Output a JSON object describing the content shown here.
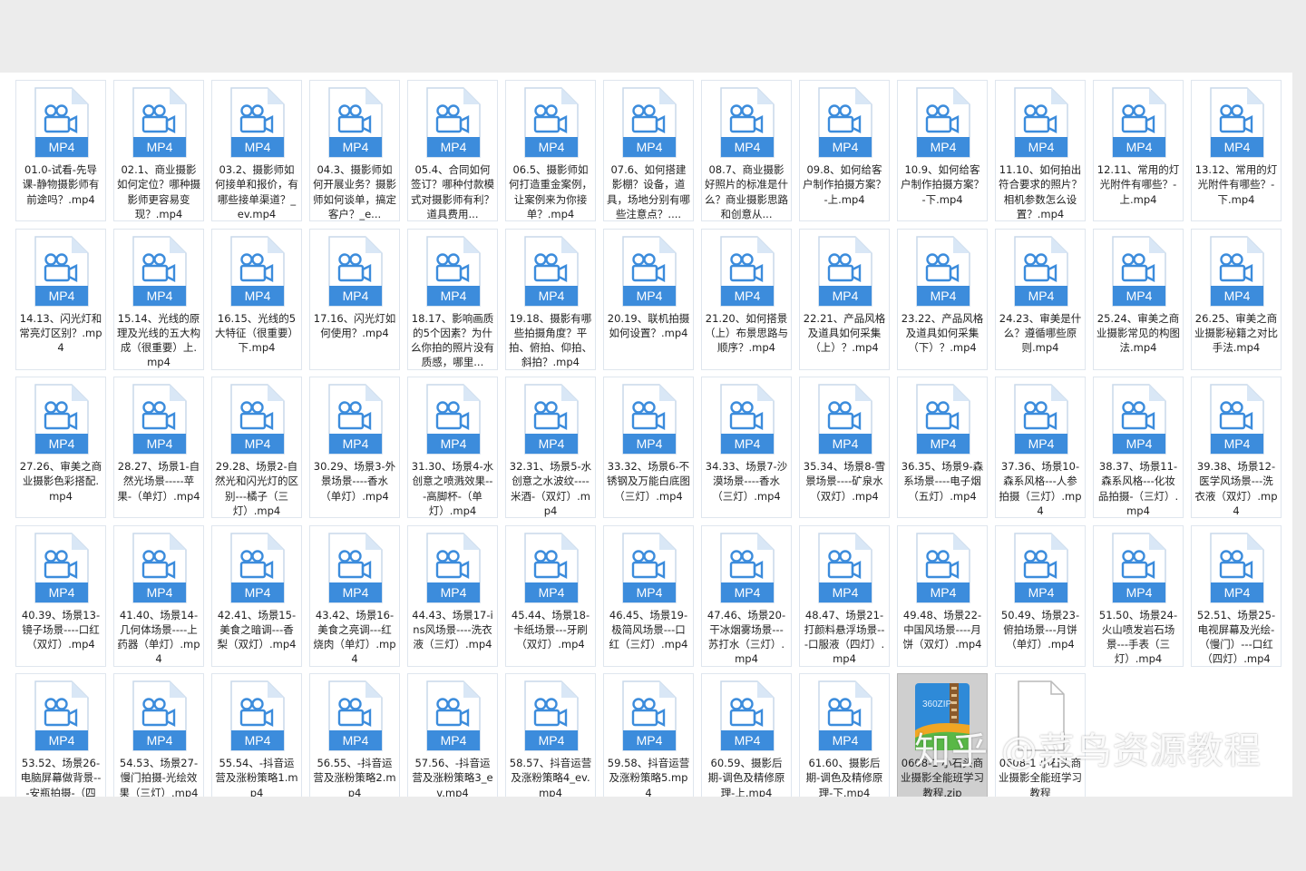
{
  "file_list": {
    "icons": {
      "mp4": "mp4-video-file-icon",
      "zip": "360zip-archive-icon",
      "blank": "blank-document-icon"
    },
    "colors": {
      "mp4_blue": "#3c8cdc",
      "folder_bg": "#ffffff"
    },
    "items": [
      {
        "type": "mp4",
        "badge": "MP4",
        "name": "01.0-试看-先导课-静物摄影师有前途吗？.mp4"
      },
      {
        "type": "mp4",
        "badge": "MP4",
        "name": "02.1、商业摄影如何定位？哪种摄影师更容易变现？.mp4"
      },
      {
        "type": "mp4",
        "badge": "MP4",
        "name": "03.2、摄影师如何接单和报价，有哪些接单渠道？_ev.mp4"
      },
      {
        "type": "mp4",
        "badge": "MP4",
        "name": "04.3、摄影师如何开展业务？摄影师如何谈单，搞定客户？_e..."
      },
      {
        "type": "mp4",
        "badge": "MP4",
        "name": "05.4、合同如何签订？哪种付款模式对摄影师有利？道具费用..."
      },
      {
        "type": "mp4",
        "badge": "MP4",
        "name": "06.5、摄影师如何打造重金案例，让案例来为你接单？.mp4"
      },
      {
        "type": "mp4",
        "badge": "MP4",
        "name": "07.6、如何搭建影棚？设备，道具，场地分别有哪些注意点？...."
      },
      {
        "type": "mp4",
        "badge": "MP4",
        "name": "08.7、商业摄影好照片的标准是什么？商业摄影思路和创意从..."
      },
      {
        "type": "mp4",
        "badge": "MP4",
        "name": "09.8、如何给客户制作拍摄方案？-上.mp4"
      },
      {
        "type": "mp4",
        "badge": "MP4",
        "name": "10.9、如何给客户制作拍摄方案？-下.mp4"
      },
      {
        "type": "mp4",
        "badge": "MP4",
        "name": "11.10、如何拍出符合要求的照片？相机参数怎么设置？.mp4"
      },
      {
        "type": "mp4",
        "badge": "MP4",
        "name": "12.11、常用的灯光附件有哪些？-上.mp4"
      },
      {
        "type": "mp4",
        "badge": "MP4",
        "name": "13.12、常用的灯光附件有哪些？-下.mp4"
      },
      {
        "type": "mp4",
        "badge": "MP4",
        "name": "14.13、闪光灯和常亮灯区别？.mp4"
      },
      {
        "type": "mp4",
        "badge": "MP4",
        "name": "15.14、光线的原理及光线的五大构成（很重要）上.mp4"
      },
      {
        "type": "mp4",
        "badge": "MP4",
        "name": "16.15、光线的5大特征（很重要）下.mp4"
      },
      {
        "type": "mp4",
        "badge": "MP4",
        "name": "17.16、闪光灯如何使用？.mp4"
      },
      {
        "type": "mp4",
        "badge": "MP4",
        "name": "18.17、影响画质的5个因素？为什么你拍的照片没有质感，哪里..."
      },
      {
        "type": "mp4",
        "badge": "MP4",
        "name": "19.18、摄影有哪些拍摄角度？平拍、俯拍、仰拍、斜拍？.mp4"
      },
      {
        "type": "mp4",
        "badge": "MP4",
        "name": "20.19、联机拍摄如何设置？.mp4"
      },
      {
        "type": "mp4",
        "badge": "MP4",
        "name": "21.20、如何搭景（上）布景思路与顺序？.mp4"
      },
      {
        "type": "mp4",
        "badge": "MP4",
        "name": "22.21、产品风格及道具如何采集（上）？.mp4"
      },
      {
        "type": "mp4",
        "badge": "MP4",
        "name": "23.22、产品风格及道具如何采集（下）？.mp4"
      },
      {
        "type": "mp4",
        "badge": "MP4",
        "name": "24.23、审美是什么？遵循哪些原则.mp4"
      },
      {
        "type": "mp4",
        "badge": "MP4",
        "name": "25.24、审美之商业摄影常见的构图法.mp4"
      },
      {
        "type": "mp4",
        "badge": "MP4",
        "name": "26.25、审美之商业摄影秘籍之对比手法.mp4"
      },
      {
        "type": "mp4",
        "badge": "MP4",
        "name": "27.26、审美之商业摄影色彩搭配.mp4"
      },
      {
        "type": "mp4",
        "badge": "MP4",
        "name": "28.27、场景1-自然光场景-----苹果-（单灯）.mp4"
      },
      {
        "type": "mp4",
        "badge": "MP4",
        "name": "29.28、场景2-自然光和闪光灯的区别---橘子（三灯）.mp4"
      },
      {
        "type": "mp4",
        "badge": "MP4",
        "name": "30.29、场景3-外景场景----香水（单灯）.mp4"
      },
      {
        "type": "mp4",
        "badge": "MP4",
        "name": "31.30、场景4-水创意之喷溅效果---高脚杯-（单灯）.mp4"
      },
      {
        "type": "mp4",
        "badge": "MP4",
        "name": "32.31、场景5-水创意之水波纹----米酒-（双灯）.mp4"
      },
      {
        "type": "mp4",
        "badge": "MP4",
        "name": "33.32、场景6-不锈钢及万能白底图（三灯）.mp4"
      },
      {
        "type": "mp4",
        "badge": "MP4",
        "name": "34.33、场景7-沙漠场景----香水（三灯）.mp4"
      },
      {
        "type": "mp4",
        "badge": "MP4",
        "name": "35.34、场景8-雪景场景----矿泉水（双灯）.mp4"
      },
      {
        "type": "mp4",
        "badge": "MP4",
        "name": "36.35、场景9-森系场景----电子烟（五灯）.mp4"
      },
      {
        "type": "mp4",
        "badge": "MP4",
        "name": "37.36、场景10-森系风格---人参拍摄（三灯）.mp4"
      },
      {
        "type": "mp4",
        "badge": "MP4",
        "name": "38.37、场景11-森系风格---化妆品拍摄-（三灯）.mp4"
      },
      {
        "type": "mp4",
        "badge": "MP4",
        "name": "39.38、场景12-医学风场景---洗衣液（双灯）.mp4"
      },
      {
        "type": "mp4",
        "badge": "MP4",
        "name": "40.39、场景13-镜子场景----口红（双灯）.mp4"
      },
      {
        "type": "mp4",
        "badge": "MP4",
        "name": "41.40、场景14-几何体场景----上药器（单灯）.mp4"
      },
      {
        "type": "mp4",
        "badge": "MP4",
        "name": "42.41、场景15-美食之暗调---香梨（双灯）.mp4"
      },
      {
        "type": "mp4",
        "badge": "MP4",
        "name": "43.42、场景16-美食之亮调---红烧肉（单灯）.mp4"
      },
      {
        "type": "mp4",
        "badge": "MP4",
        "name": "44.43、场景17-ins风场景----洗衣液（三灯）.mp4"
      },
      {
        "type": "mp4",
        "badge": "MP4",
        "name": "45.44、场景18-卡纸场景---牙刷（双灯）.mp4"
      },
      {
        "type": "mp4",
        "badge": "MP4",
        "name": "46.45、场景19-极简风场景---口红（三灯）.mp4"
      },
      {
        "type": "mp4",
        "badge": "MP4",
        "name": "47.46、场景20-干冰烟雾场景---苏打水（三灯）.mp4"
      },
      {
        "type": "mp4",
        "badge": "MP4",
        "name": "48.47、场景21-打颜料悬浮场景---口服液（四灯）.mp4"
      },
      {
        "type": "mp4",
        "badge": "MP4",
        "name": "49.48、场景22-中国风场景----月饼（双灯）.mp4"
      },
      {
        "type": "mp4",
        "badge": "MP4",
        "name": "50.49、场景23-俯拍场景---月饼（单灯）.mp4"
      },
      {
        "type": "mp4",
        "badge": "MP4",
        "name": "51.50、场景24-火山喷发岩石场景---手表（三灯）.mp4"
      },
      {
        "type": "mp4",
        "badge": "MP4",
        "name": "52.51、场景25-电视屏幕及光绘-（慢门）---口红（四灯）.mp4"
      },
      {
        "type": "mp4",
        "badge": "MP4",
        "name": "53.52、场景26-电脑屏幕做背景---安瓶拍摄-（四"
      },
      {
        "type": "mp4",
        "badge": "MP4",
        "name": "54.53、场景27-慢门拍摄-光绘效果（三灯）.mp4"
      },
      {
        "type": "mp4",
        "badge": "MP4",
        "name": "55.54、-抖音运营及涨粉策略1.mp4"
      },
      {
        "type": "mp4",
        "badge": "MP4",
        "name": "56.55、-抖音运营及涨粉策略2.mp4"
      },
      {
        "type": "mp4",
        "badge": "MP4",
        "name": "57.56、-抖音运营及涨粉策略3_ev.mp4"
      },
      {
        "type": "mp4",
        "badge": "MP4",
        "name": "58.57、抖音运营及涨粉策略4_ev.mp4"
      },
      {
        "type": "mp4",
        "badge": "MP4",
        "name": "59.58、抖音运营及涨粉策略5.mp4"
      },
      {
        "type": "mp4",
        "badge": "MP4",
        "name": "60.59、摄影后期-调色及精修原理-上.mp4"
      },
      {
        "type": "mp4",
        "badge": "MP4",
        "name": "61.60、摄影后期-调色及精修原理-下.mp4"
      },
      {
        "type": "zip",
        "badge": "360ZIP",
        "name": "0608-1 小石头商业摄影全能班学习教程.zip",
        "selected": true
      },
      {
        "type": "blank",
        "badge": "",
        "name": "0608-1 小石头商业摄影全能班学习教程"
      }
    ]
  },
  "watermark": {
    "text": "知乎 @菜鸟资源教程"
  }
}
